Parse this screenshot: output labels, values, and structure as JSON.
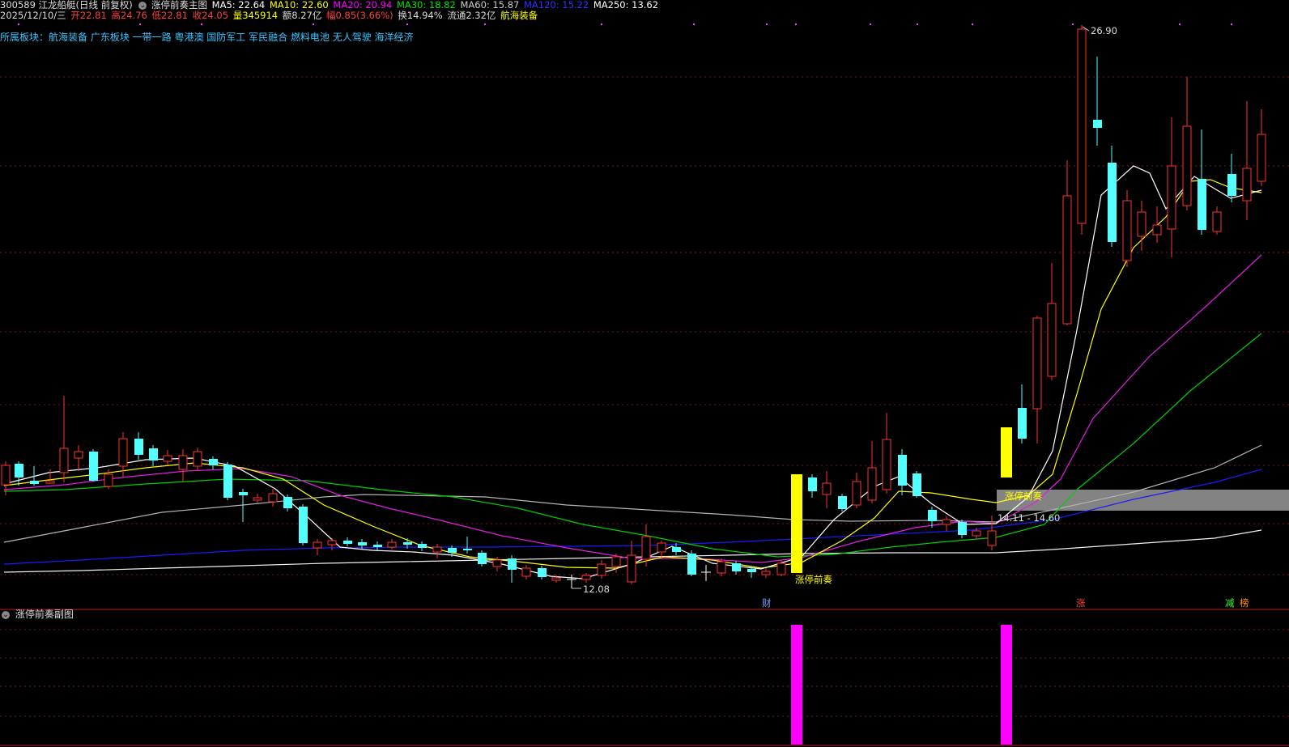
{
  "header": {
    "code_name": "300589 江龙船艇(日线 前复权)",
    "indicator_name": "涨停前奏主图",
    "ma5": "MA5: 22.64",
    "ma10": "MA10: 22.60",
    "ma20": "MA20: 20.94",
    "ma30": "MA30: 18.82",
    "ma60": "MA60: 15.87",
    "ma120": "MA120: 15.22",
    "ma250": "MA250: 13.62"
  },
  "quote": {
    "date": "2025/12/10/三",
    "open": "开22.81",
    "high": "高24.76",
    "low": "低22.81",
    "close": "收24.05",
    "volume": "量345914",
    "amount": "额8.27亿",
    "change": "幅0.85(3.66%)",
    "turnover": "换14.94%",
    "float": "流通2.32亿",
    "sector": "航海装备"
  },
  "sectors_line": "所属板块：航海装备 广东板块 一带一路 粤港澳 国防军工 军民融合 燃料电池 无人驾驶 海洋经济",
  "annotations": {
    "high_price": "26.90",
    "low_price": "12.08",
    "range_label": "14.11 - 14.60",
    "signal_label_1": "涨停前奏",
    "signal_label_2": "涨停前奏",
    "marker_cai": "财",
    "marker_zhang": "涨",
    "marker_jian": "减",
    "marker_bang": "榜"
  },
  "sub_panel": {
    "title": "涨停前奏副图"
  },
  "colors": {
    "up": "#ff3232",
    "down": "#54ffff",
    "ma5": "#ffffff",
    "ma10": "#ffff00",
    "ma20": "#ff00ff",
    "ma30": "#00e000",
    "ma60": "#cccccc",
    "ma120": "#0000ff",
    "ma250": "#ffffff",
    "signal_bar": "#ffff00",
    "sub_bar": "#ff00ff"
  }
}
